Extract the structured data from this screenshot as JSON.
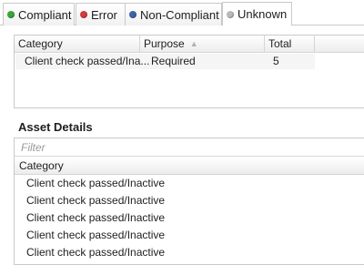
{
  "tabs": [
    {
      "label": "Compliant",
      "color": "#3aa63a",
      "active": false
    },
    {
      "label": "Error",
      "color": "#d23c3c",
      "active": false
    },
    {
      "label": "Non-Compliant",
      "color": "#3f63a8",
      "active": false
    },
    {
      "label": "Unknown",
      "color": "#b9b9b9",
      "active": true
    }
  ],
  "summary": {
    "columns": [
      "Category",
      "Purpose",
      "Total"
    ],
    "sort_icon": "sort-ascending-icon",
    "rows": [
      {
        "category": "Client check passed/Ina...",
        "purpose": "Required",
        "total": "5"
      }
    ]
  },
  "asset_details": {
    "title": "Asset Details",
    "filter_placeholder": "Filter",
    "column": "Category",
    "rows": [
      "Client check passed/Inactive",
      "Client check passed/Inactive",
      "Client check passed/Inactive",
      "Client check passed/Inactive",
      "Client check passed/Inactive"
    ]
  }
}
